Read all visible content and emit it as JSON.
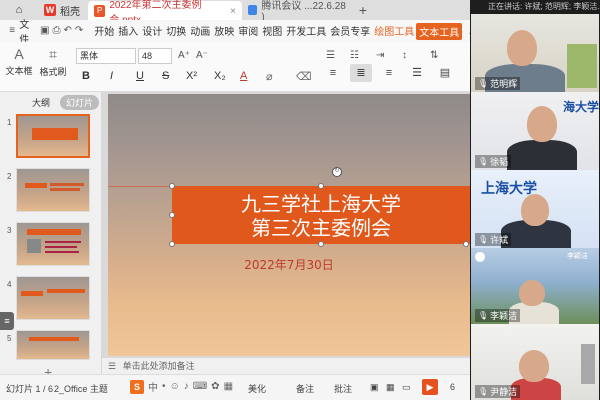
{
  "tabbar": {
    "home_label": "⌂",
    "wps_label": "稻壳",
    "doc_label": "2022年第二次主委例会.pptx",
    "doc2_label": "腾讯会议   ...22.6.28 )",
    "add_label": "+"
  },
  "menubar": {
    "file_label": "文件",
    "tabs": [
      "开始",
      "插入",
      "设计",
      "切换",
      "动画",
      "放映",
      "审阅",
      "视图",
      "开发工具",
      "会员专享"
    ],
    "drawing_tools": "绘图工具",
    "text_tools": "文本工具"
  },
  "ribbon": {
    "text_box": "文本框",
    "wrap": "格式刷",
    "font_name": "黑体",
    "font_size": "48",
    "bold": "B",
    "italic": "I",
    "underline": "U",
    "strike": "S",
    "superscript": "X²",
    "subscript": "X₂",
    "font_color": "A",
    "clear": "⌫"
  },
  "panel": {
    "outline_label": "大纲",
    "slides_label": "幻灯片",
    "add": "+",
    "slide_numbers": [
      "1",
      "2",
      "3",
      "4",
      "5"
    ]
  },
  "slide": {
    "title_line1": "九三学社上海大学",
    "title_line2": "第三次主委例会",
    "date": "2022年7月30日"
  },
  "notes": {
    "placeholder": "单击此处添加备注"
  },
  "status": {
    "slide_counter": "幻灯片 1 / 6",
    "theme": "2_Office 主题",
    "ime_mode": "中",
    "beautify": "美化",
    "notes_btn": "备注",
    "comments_btn": "批注",
    "zoom": "6"
  },
  "meeting": {
    "speaking": "正在讲话: 许斌; 范明辉; 李颖洁...",
    "participants": [
      {
        "name": "范明辉"
      },
      {
        "name": "徐韬"
      },
      {
        "name": "许斌"
      },
      {
        "name": "李颖洁"
      },
      {
        "name": "尹静洁"
      }
    ],
    "tile2_caption": "海大学",
    "tile3_caption": "上海大学",
    "tile4_caption": "李颖洁"
  }
}
